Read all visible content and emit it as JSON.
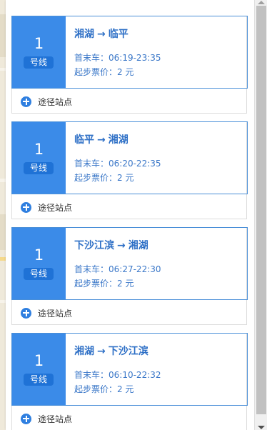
{
  "action_label": "途径站点",
  "unit_label": "号线",
  "first_last_label": "首末车：",
  "price_label": "起步票价：",
  "lines": [
    {
      "number": "1",
      "from": "湘湖",
      "to": "临平",
      "hours": "06:19-23:35",
      "price": "2 元"
    },
    {
      "number": "1",
      "from": "临平",
      "to": "湘湖",
      "hours": "06:20-22:35",
      "price": "2 元"
    },
    {
      "number": "1",
      "from": "下沙江滨",
      "to": "湘湖",
      "hours": "06:27-22:30",
      "price": "2 元"
    },
    {
      "number": "1",
      "from": "湘湖",
      "to": "下沙江滨",
      "hours": "06:10-22:32",
      "price": "2 元"
    }
  ],
  "colors": {
    "badge": "#3b8be8",
    "badge_unit": "#1f72d6",
    "link_text": "#2d6fc6",
    "plus_icon": "#2f7fe0"
  }
}
